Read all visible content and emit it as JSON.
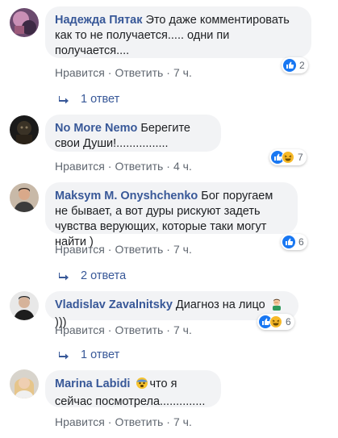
{
  "comments": [
    {
      "author": "Надежда Пятак",
      "text": " Это даже комментировать как то не получается..... одни пи получается....",
      "reaction_count": "2",
      "like": "Нравится",
      "reply": "Ответить",
      "time": "7 ч.",
      "replies": "1 ответ"
    },
    {
      "author": "No More Nemo",
      "text": " Берегите свои Души!................",
      "reaction_count": "7",
      "like": "Нравится",
      "reply": "Ответить",
      "time": "4 ч."
    },
    {
      "author": "Maksym M. Onyshchenko",
      "text": " Бог поругаем не бывает, а вот дуры рискуют задеть чувства верующих, которые таки могут найти )",
      "reaction_count": "6",
      "like": "Нравится",
      "reply": "Ответить",
      "time": "7 ч.",
      "replies": "2 ответа"
    },
    {
      "author": "Vladislav Zavalnitsky",
      "text_before": " Диагноз на лицо",
      "text_after": ")))",
      "reaction_count": "6",
      "like": "Нравится",
      "reply": "Ответить",
      "time": "7 ч.",
      "replies": "1 ответ"
    },
    {
      "author": "Marina Labidi",
      "text": "что я сейчас посмотрела..............",
      "like": "Нравится",
      "reply": "Ответить",
      "time": "7 ч."
    }
  ],
  "colors": {
    "author": "#385898",
    "bubble_bg": "#f2f3f5",
    "meta": "#606770",
    "like_blue": "#1877f2",
    "haha_yellow": "#f7b928"
  }
}
